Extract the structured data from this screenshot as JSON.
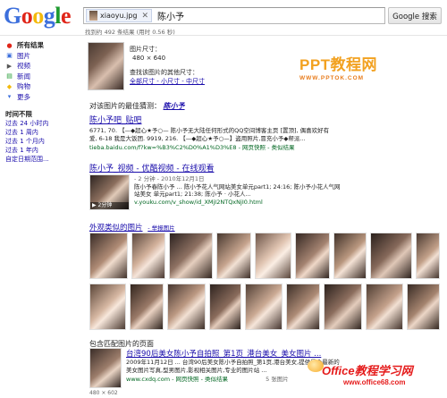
{
  "header": {
    "logo": [
      "G",
      "o",
      "o",
      "g",
      "l",
      "e"
    ],
    "logo_colors": [
      "#3c6fdc",
      "#e0261a",
      "#f3b90c",
      "#3c6fdc",
      "#1e9a2f",
      "#e0261a"
    ],
    "image_chip": "xiaoyu.jpg",
    "query": "陈小予",
    "search_button": "Google 搜索",
    "result_stats": "找到约 492 条结果 (用时 0.56 秒)"
  },
  "sidebar": {
    "items": [
      {
        "label": "所有结果",
        "icon": "all-results-icon",
        "active": true
      },
      {
        "label": "图片",
        "icon": "images-icon"
      },
      {
        "label": "视频",
        "icon": "videos-icon"
      },
      {
        "label": "新闻",
        "icon": "news-icon"
      },
      {
        "label": "购物",
        "icon": "shopping-icon"
      },
      {
        "label": "更多",
        "icon": "more-icon"
      }
    ],
    "time_heading": "时间不限",
    "time_links": [
      "过去 24 小时内",
      "过去 1 周内",
      "过去 1 个月内",
      "过去 1 年内",
      "自定日期范围..."
    ]
  },
  "query_image": {
    "size_label": "图片尺寸：",
    "size_value": "480 × 640",
    "other_sizes_label": "查找该图片的其他尺寸：",
    "other_sizes_links": "全部尺寸 - 小尺寸 - 中尺寸"
  },
  "best_guess": {
    "label": "对该图片的最佳猜测：",
    "value": "陈小予"
  },
  "result1": {
    "title": "陈小予吧_贴吧",
    "snippet1": "6771, 70. 【—◆超心★予○— 陈小予无大陆任何形式的QQ空间博客主页 [置顶], 偶喜欢好有",
    "snippet2": "爱, 6-18 我是大饭团. 9919, 216. 【—◆超心★予○—】盗用照片,冒充小予◆帮派...",
    "url": "tieba.baidu.com/f?kw=%B3%C2%D0%A1%D3%E8 - 网页快照 - 类似结果"
  },
  "result2": {
    "title": "陈小予_视频 - 优酷视频 - 在线观看",
    "duration": "2分钟",
    "meta": "- 2 分钟 - 2010年12月1日",
    "snippet1": "陈小予春陈小予 ... 陈小予花人气网站美女单元part1; 24:16; 陈小予小花人气网",
    "snippet2": "站美女 单元part1; 21:38; 陈小予 · 小花人...",
    "url": "v.youku.com/v_show/id_XMjI2NTQxNjI0.html"
  },
  "similar": {
    "title": "外观类似的图片",
    "report": "- 举报图片"
  },
  "pages": {
    "heading": "包含匹配图片的页面",
    "title": "台湾90后美女陈小予自拍照_第1页_港台美女_美女图片 ...",
    "snippet1": "2009年11月12日 ... 台湾90后美女陈小予自拍照_第1页,港台美女,提供最全最新的",
    "snippet2": "美女图片写真,型男图片,影视相关图片,专业的图片站 ...",
    "url": "www.cxdq.com - 网页快照 - 类似结果",
    "extra": "5 张图片",
    "size": "480 × 602"
  },
  "ppt_watermark": {
    "brand_main": "PPT教程网",
    "brand_url": "WWW.PPTOK.COM"
  },
  "office_watermark": {
    "brand": "Office教程学习网",
    "url": "www.office68.com"
  }
}
